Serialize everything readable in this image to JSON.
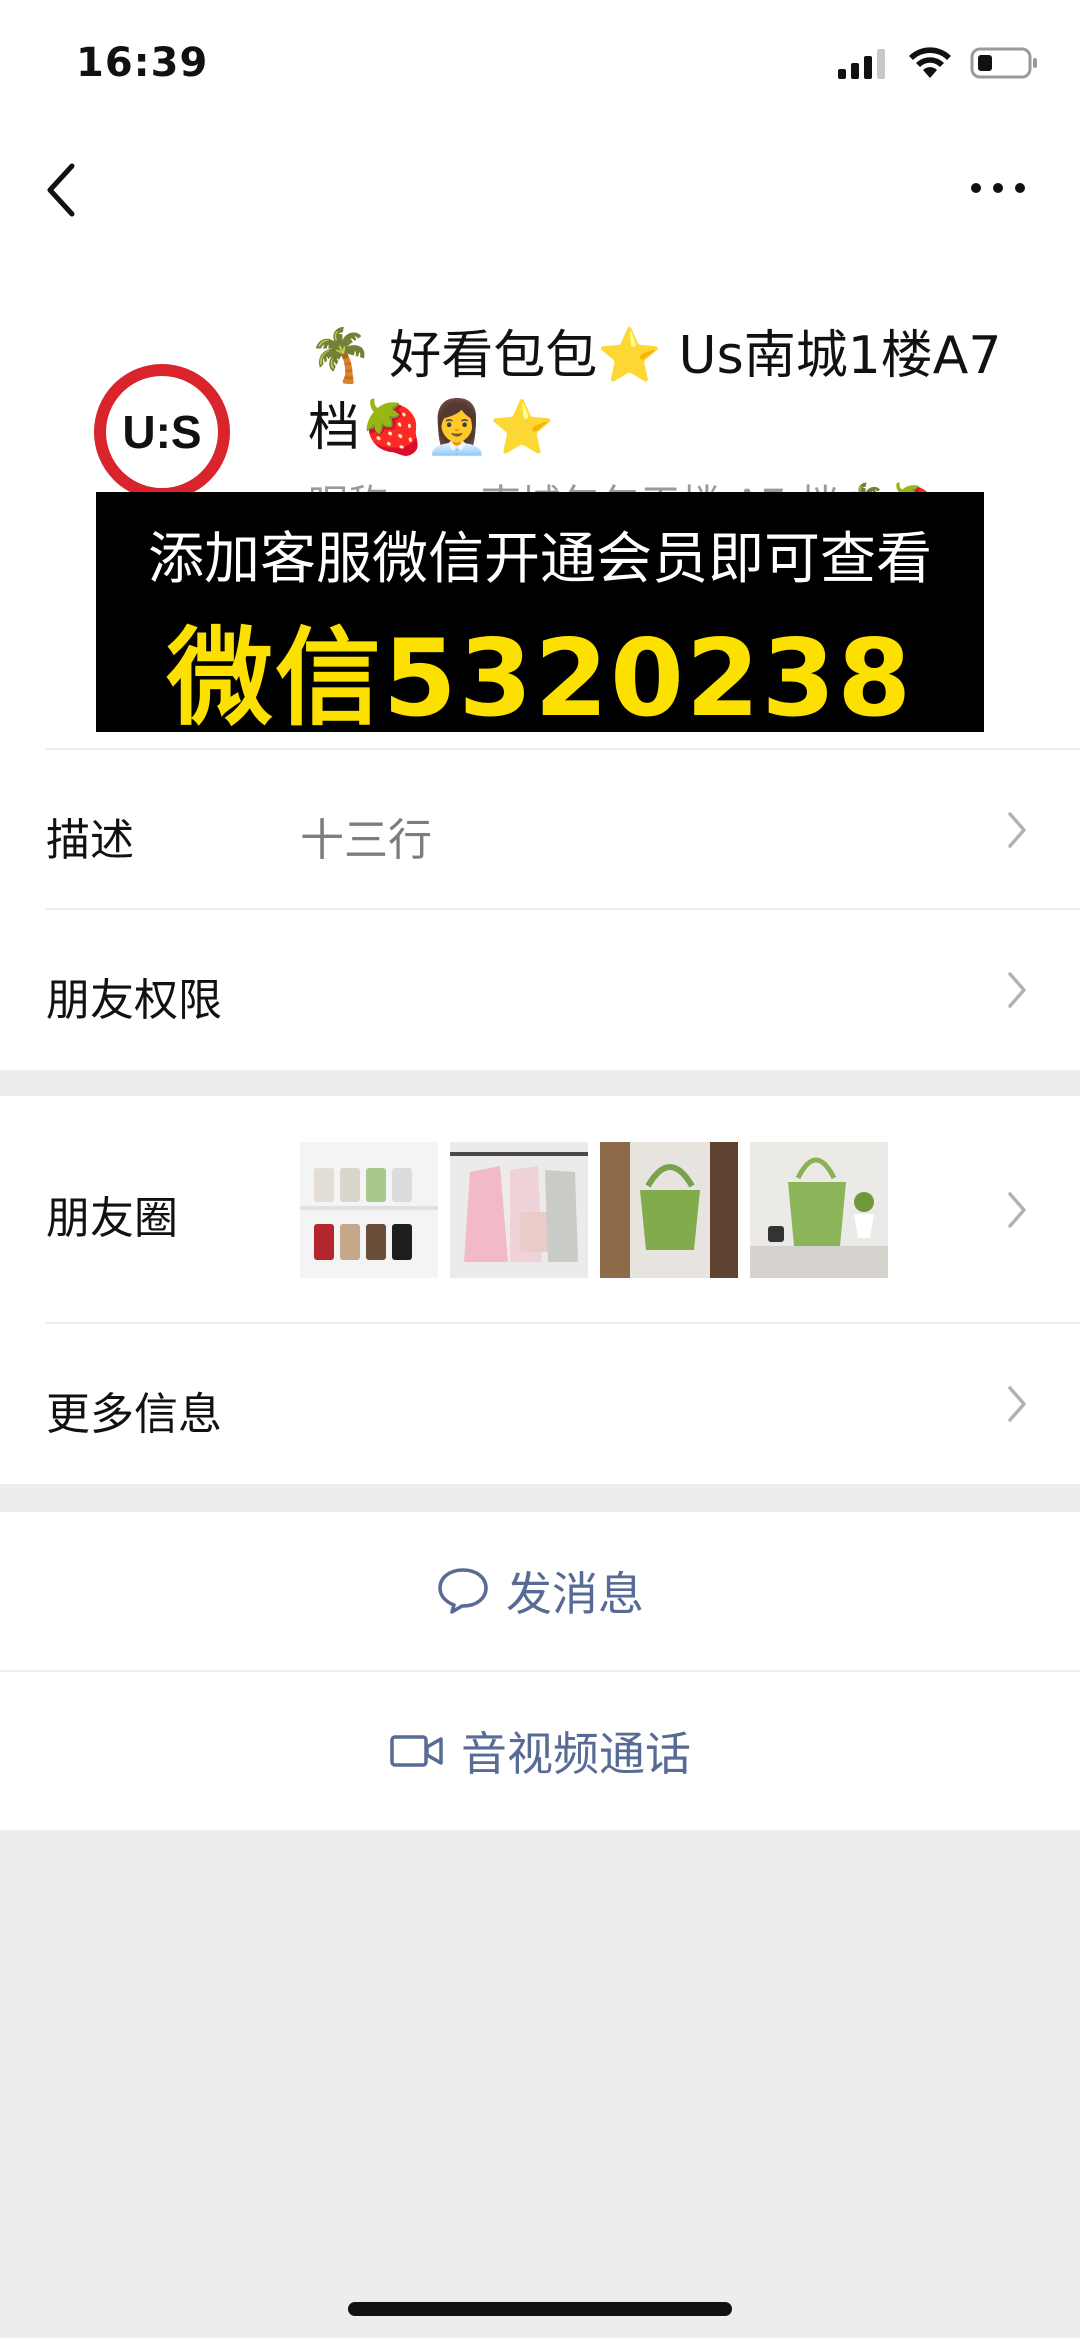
{
  "status_bar": {
    "time": "16:39"
  },
  "nav": {
    "back_icon": "chevron-left-icon",
    "more_icon": "more-dots-icon"
  },
  "profile": {
    "avatar_text": "U:S",
    "name": "🌴 好看包包⭐ Us南城1楼A7档🍓👩‍💼⭐",
    "subtext": "昵称：… 南城包包天楼 A7 档🌴🍓"
  },
  "banner": {
    "line1": "添加客服微信开通会员即可查看",
    "line2": "微信5320238"
  },
  "rows": {
    "description_label": "描述",
    "description_value": "十三行",
    "permissions_label": "朋友权限",
    "moments_label": "朋友圈",
    "more_info_label": "更多信息"
  },
  "actions": {
    "message_label": "发消息",
    "call_label": "音视频通话"
  },
  "colors": {
    "link": "#576b95",
    "banner_yellow": "#fbe000",
    "avatar_red": "#d8242a"
  }
}
